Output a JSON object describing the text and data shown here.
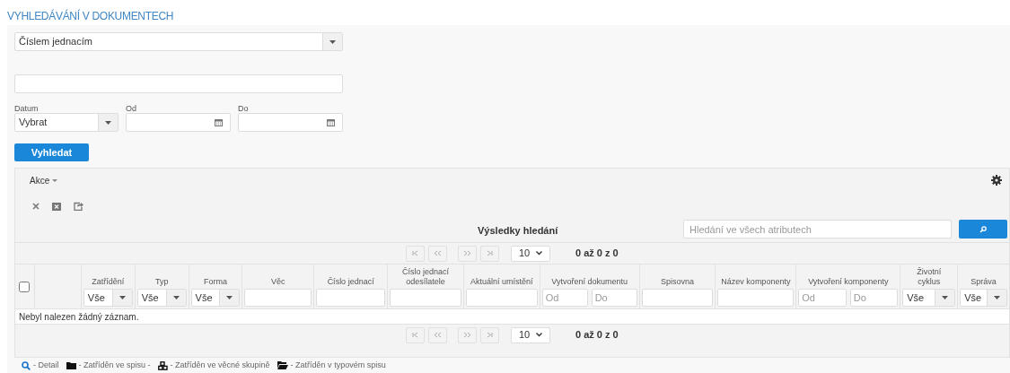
{
  "title": "VYHLEDÁVÁNÍ V DOKUMENTECH",
  "search_by": {
    "value": "Číslem jednacím"
  },
  "date_filter": {
    "label": "Datum",
    "value": "Vybrat",
    "from_label": "Od",
    "to_label": "Do"
  },
  "search_button": "Vyhledat",
  "results": {
    "actions_menu": "Akce",
    "title": "Výsledky hledání",
    "search_placeholder": "Hledání ve všech atributech",
    "pager_top": {
      "page_size": "10",
      "range": "0 až 0 z 0"
    },
    "columns": [
      {
        "filter": {
          "kind": "checkbox",
          "checked": false
        }
      },
      {
        "filter": {
          "kind": "none"
        }
      },
      {
        "label": "Zatřídění",
        "filter": {
          "kind": "select",
          "value": "Vše"
        }
      },
      {
        "label": "Typ",
        "filter": {
          "kind": "select",
          "value": "Vše"
        }
      },
      {
        "label": "Forma",
        "filter": {
          "kind": "select",
          "value": "Vše"
        }
      },
      {
        "label": "Věc",
        "filter": {
          "kind": "text"
        }
      },
      {
        "label": "Číslo jednací",
        "filter": {
          "kind": "text"
        }
      },
      {
        "label": "Číslo jednací odesílatele",
        "filter": {
          "kind": "text"
        }
      },
      {
        "label": "Aktuální umístění",
        "filter": {
          "kind": "text"
        }
      },
      {
        "label": "Vytvoření dokumentu",
        "filter": {
          "kind": "range",
          "from_placeholder": "Od",
          "to_placeholder": "Do"
        }
      },
      {
        "label": "Spisovna",
        "filter": {
          "kind": "text"
        }
      },
      {
        "label": "Název komponenty",
        "filter": {
          "kind": "text"
        }
      },
      {
        "label": "Vytvoření komponenty",
        "filter": {
          "kind": "range",
          "from_placeholder": "Od",
          "to_placeholder": "Do"
        }
      },
      {
        "label": "Životní cyklus",
        "filter": {
          "kind": "select",
          "value": "Vše"
        }
      },
      {
        "label": "Správa",
        "filter": {
          "kind": "select",
          "value": "Vše"
        }
      }
    ],
    "empty_message": "Nebyl nalezen žádný záznam.",
    "pager_bottom": {
      "page_size": "10",
      "range": "0 až 0 z 0"
    }
  },
  "legend": [
    {
      "kind": "detail",
      "text": "- Detail"
    },
    {
      "kind": "file",
      "text": "- Zatříděn ve spisu -"
    },
    {
      "kind": "group",
      "text": "- Zatříděn ve věcné skupině"
    },
    {
      "kind": "typefile",
      "text": "- Zatříděn v typovém spisu"
    }
  ]
}
